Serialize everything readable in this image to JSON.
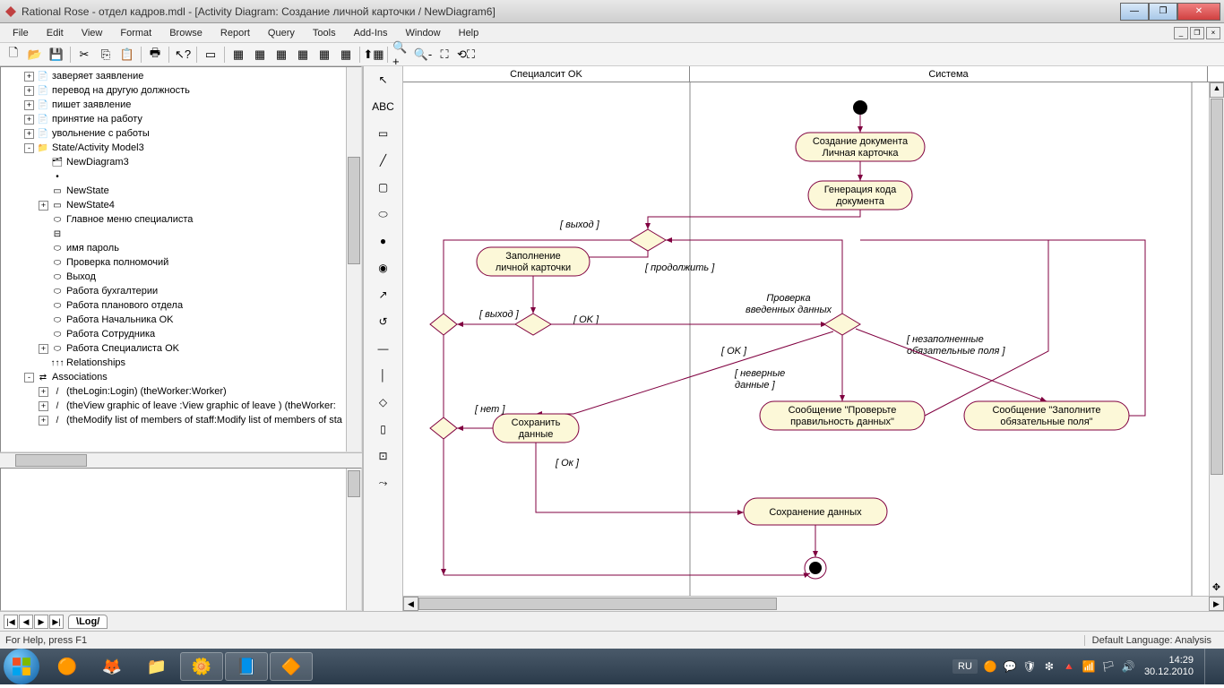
{
  "window": {
    "title": "Rational Rose - отдел кадров.mdl - [Activity Diagram: Создание личной карточки / NewDiagram6]"
  },
  "menu": {
    "items": [
      "File",
      "Edit",
      "View",
      "Format",
      "Browse",
      "Report",
      "Query",
      "Tools",
      "Add-Ins",
      "Window",
      "Help"
    ]
  },
  "palette": {
    "text_tool": "ABC"
  },
  "tree": {
    "items": [
      {
        "indent": 1,
        "exp": "+",
        "icon": "📄",
        "label": "заверяет заявление"
      },
      {
        "indent": 1,
        "exp": "+",
        "icon": "📄",
        "label": "перевод на другую должность"
      },
      {
        "indent": 1,
        "exp": "+",
        "icon": "📄",
        "label": "пишет заявление"
      },
      {
        "indent": 1,
        "exp": "+",
        "icon": "📄",
        "label": "принятие на работу"
      },
      {
        "indent": 1,
        "exp": "+",
        "icon": "📄",
        "label": "увольнение с работы"
      },
      {
        "indent": 1,
        "exp": "-",
        "icon": "📁",
        "label": "State/Activity Model3"
      },
      {
        "indent": 2,
        "exp": "",
        "icon": "🗂",
        "label": "NewDiagram3"
      },
      {
        "indent": 2,
        "exp": "",
        "icon": "•",
        "label": ""
      },
      {
        "indent": 2,
        "exp": "",
        "icon": "▭",
        "label": "NewState"
      },
      {
        "indent": 2,
        "exp": "+",
        "icon": "▭",
        "label": "NewState4"
      },
      {
        "indent": 2,
        "exp": "",
        "icon": "⬭",
        "label": "Главное меню специалиста"
      },
      {
        "indent": 2,
        "exp": "",
        "icon": "⊟",
        "label": ""
      },
      {
        "indent": 2,
        "exp": "",
        "icon": "⬭",
        "label": "имя пароль"
      },
      {
        "indent": 2,
        "exp": "",
        "icon": "⬭",
        "label": "Проверка полномочий"
      },
      {
        "indent": 2,
        "exp": "",
        "icon": "⬭",
        "label": "Выход"
      },
      {
        "indent": 2,
        "exp": "",
        "icon": "⬭",
        "label": "Работа  бухгалтерии"
      },
      {
        "indent": 2,
        "exp": "",
        "icon": "⬭",
        "label": "Работа  планового отдела"
      },
      {
        "indent": 2,
        "exp": "",
        "icon": "⬭",
        "label": "Работа Начальника OK"
      },
      {
        "indent": 2,
        "exp": "",
        "icon": "⬭",
        "label": "Работа Сотрудника"
      },
      {
        "indent": 2,
        "exp": "+",
        "icon": "⬭",
        "label": "Работа Специалиста OK"
      },
      {
        "indent": 2,
        "exp": "",
        "icon": "↑↑↑",
        "label": "Relationships"
      },
      {
        "indent": 1,
        "exp": "-",
        "icon": "⇄",
        "label": "Associations"
      },
      {
        "indent": 2,
        "exp": "+",
        "icon": "/",
        "label": "(theLogin:Login) (theWorker:Worker)"
      },
      {
        "indent": 2,
        "exp": "+",
        "icon": "/",
        "label": "(theView graphic of leave :View graphic of leave ) (theWorker:"
      },
      {
        "indent": 2,
        "exp": "+",
        "icon": "/",
        "label": "(theModify list of members of staff:Modify list of members of sta"
      }
    ]
  },
  "swimlanes": {
    "left": "Специалсит OK",
    "right": "Система"
  },
  "diagram": {
    "nodes": {
      "create_doc_l1": "Создание документа",
      "create_doc_l2": "Личная карточка",
      "gen_code_l1": "Генерация кода",
      "gen_code_l2": "документа",
      "fill_card_l1": "Заполнение",
      "fill_card_l2": "личной карточки",
      "check_l1": "Проверка",
      "check_l2": "введенных данных",
      "msg_correct_l1": "Сообщение \"Проверьте",
      "msg_correct_l2": "правильность данных\"",
      "msg_fill_l1": "Сообщение \"Заполните",
      "msg_fill_l2": "обязательные поля\"",
      "save_l1": "Сохранить",
      "save_l2": "данные",
      "saving": "Сохранение данных"
    },
    "guards": {
      "exit1": "[ выход ]",
      "cont": "[ продолжить ]",
      "exit2": "[ выход ]",
      "ok1": "[ OK ]",
      "ok2": "[ OK ]",
      "unfilled_l1": "[ незаполненные",
      "unfilled_l2": "обязательные поля ]",
      "wrong_l1": "[ неверные",
      "wrong_l2": "данные ]",
      "no": "[ нет ]",
      "ok3": "[ Ок ]"
    }
  },
  "log": {
    "tab": "Log"
  },
  "status": {
    "help": "For Help, press F1",
    "lang": "Default Language: Analysis"
  },
  "taskbar": {
    "lang": "RU",
    "time": "14:29",
    "date": "30.12.2010"
  }
}
